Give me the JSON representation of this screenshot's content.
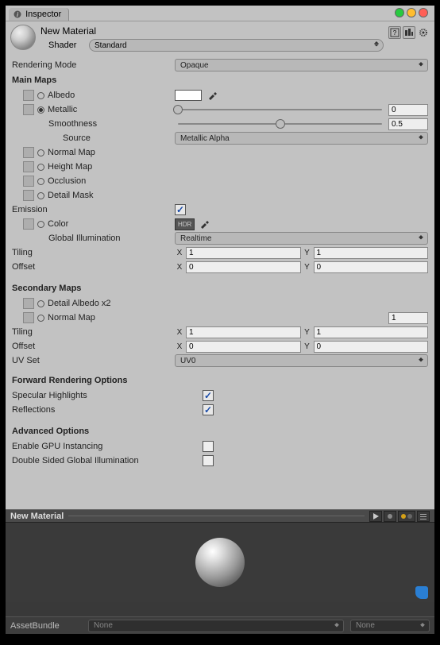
{
  "tab": {
    "label": "Inspector"
  },
  "header": {
    "material_name": "New Material",
    "shader_label": "Shader",
    "shader_value": "Standard"
  },
  "rendering_mode": {
    "label": "Rendering Mode",
    "value": "Opaque"
  },
  "main_maps": {
    "title": "Main Maps",
    "albedo": "Albedo",
    "metallic": "Metallic",
    "metallic_value": "0",
    "smoothness": "Smoothness",
    "smoothness_value": "0.5",
    "source": "Source",
    "source_value": "Metallic Alpha",
    "normal": "Normal Map",
    "height": "Height Map",
    "occlusion": "Occlusion",
    "detailmask": "Detail Mask",
    "emission": "Emission",
    "color": "Color",
    "hdr": "HDR",
    "gi": "Global Illumination",
    "gi_value": "Realtime",
    "tiling": "Tiling",
    "tiling_x": "1",
    "tiling_y": "1",
    "offset": "Offset",
    "offset_x": "0",
    "offset_y": "0"
  },
  "secondary": {
    "title": "Secondary Maps",
    "detail_albedo": "Detail Albedo x2",
    "normal": "Normal Map",
    "normal_value": "1",
    "tiling": "Tiling",
    "tiling_x": "1",
    "tiling_y": "1",
    "offset": "Offset",
    "offset_x": "0",
    "offset_y": "0",
    "uvset": "UV Set",
    "uvset_value": "UV0"
  },
  "forward": {
    "title": "Forward Rendering Options",
    "specular": "Specular Highlights",
    "reflections": "Reflections"
  },
  "advanced": {
    "title": "Advanced Options",
    "gpu": "Enable GPU Instancing",
    "doublesided": "Double Sided Global Illumination"
  },
  "preview": {
    "title": "New Material"
  },
  "assetbundle": {
    "label": "AssetBundle",
    "value": "None",
    "variant": "None"
  }
}
